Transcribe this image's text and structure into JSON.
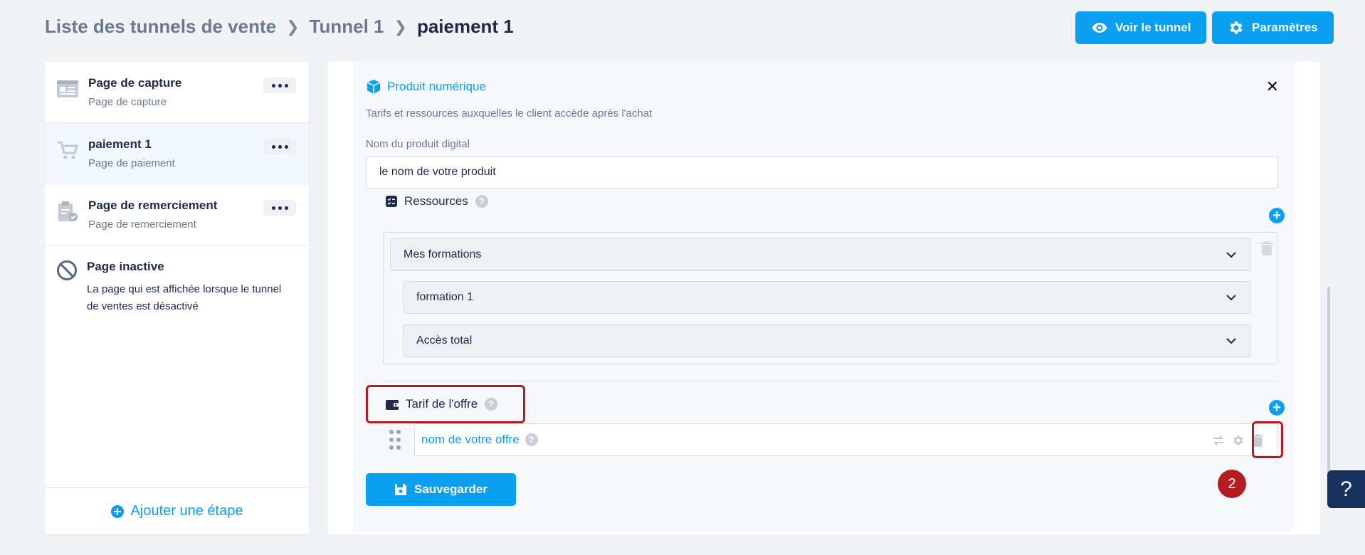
{
  "breadcrumb": {
    "items": [
      "Liste des tunnels de vente",
      "Tunnel 1"
    ],
    "current": "paiement 1"
  },
  "header": {
    "view_tunnel_label": "Voir le tunnel",
    "settings_label": "Paramètres"
  },
  "sidebar": {
    "steps": [
      {
        "title": "Page de capture",
        "subtitle": "Page de capture"
      },
      {
        "title": "paiement 1",
        "subtitle": "Page de paiement"
      },
      {
        "title": "Page de remerciement",
        "subtitle": "Page de remerciement"
      }
    ],
    "inactive": {
      "title": "Page inactive",
      "description": "La page qui est affichée lorsque le tunnel de ventes est désactivé"
    },
    "add_step_label": "Ajouter une étape"
  },
  "product": {
    "title": "Produit numérique",
    "description": "Tarifs et ressources auxquelles le client accède après l'achat",
    "name_label": "Nom du produit digital",
    "name_value": "le nom de votre produit"
  },
  "resources": {
    "label": "Ressources",
    "select_primary": "Mes formations",
    "select_formation": "formation 1",
    "select_access": "Accès total"
  },
  "pricing": {
    "label": "Tarif de l'offre",
    "offer_name": "nom de votre offre"
  },
  "save_label": "Sauvegarder",
  "badge_number": "2",
  "help_label": "?",
  "colors": {
    "accent": "#0b9ff0",
    "highlight": "#b21c22",
    "navy": "#17325e"
  }
}
